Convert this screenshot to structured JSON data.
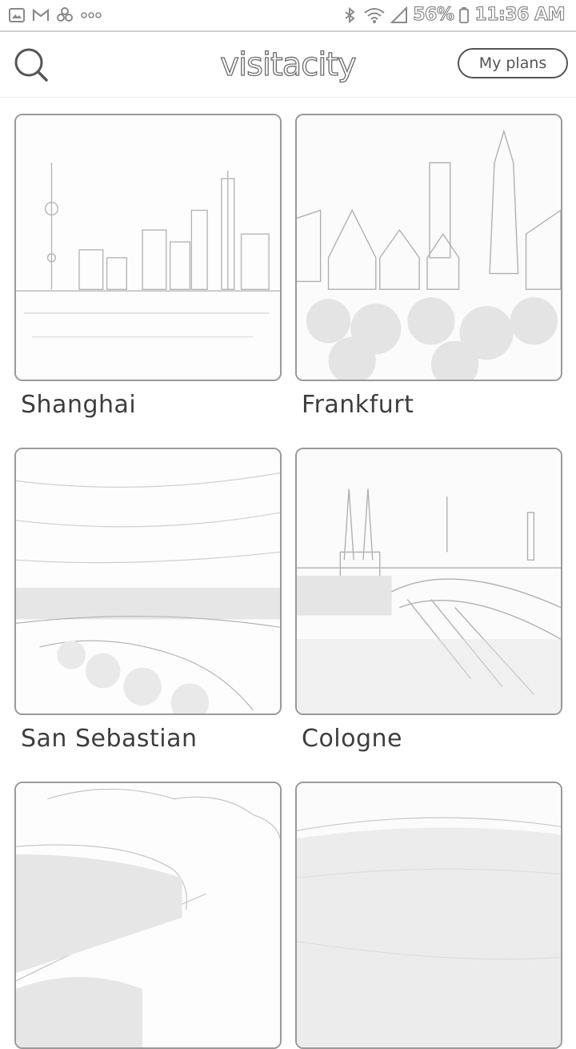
{
  "status_bar": {
    "left_icons": [
      "gallery-icon",
      "gmail-icon",
      "pinwheel-icon",
      "more-dots-icon"
    ],
    "right_icons": [
      "bluetooth-icon",
      "wifi-icon",
      "signal-icon",
      "battery-icon"
    ],
    "battery": "56%",
    "time": "11:36 AM"
  },
  "header": {
    "logo": "visitacity",
    "my_plans": "My plans",
    "search_icon": "search-icon"
  },
  "cities": [
    {
      "name": "Shanghai"
    },
    {
      "name": "Frankfurt"
    },
    {
      "name": "San Sebastian"
    },
    {
      "name": "Cologne"
    },
    {
      "name": ""
    },
    {
      "name": ""
    }
  ]
}
